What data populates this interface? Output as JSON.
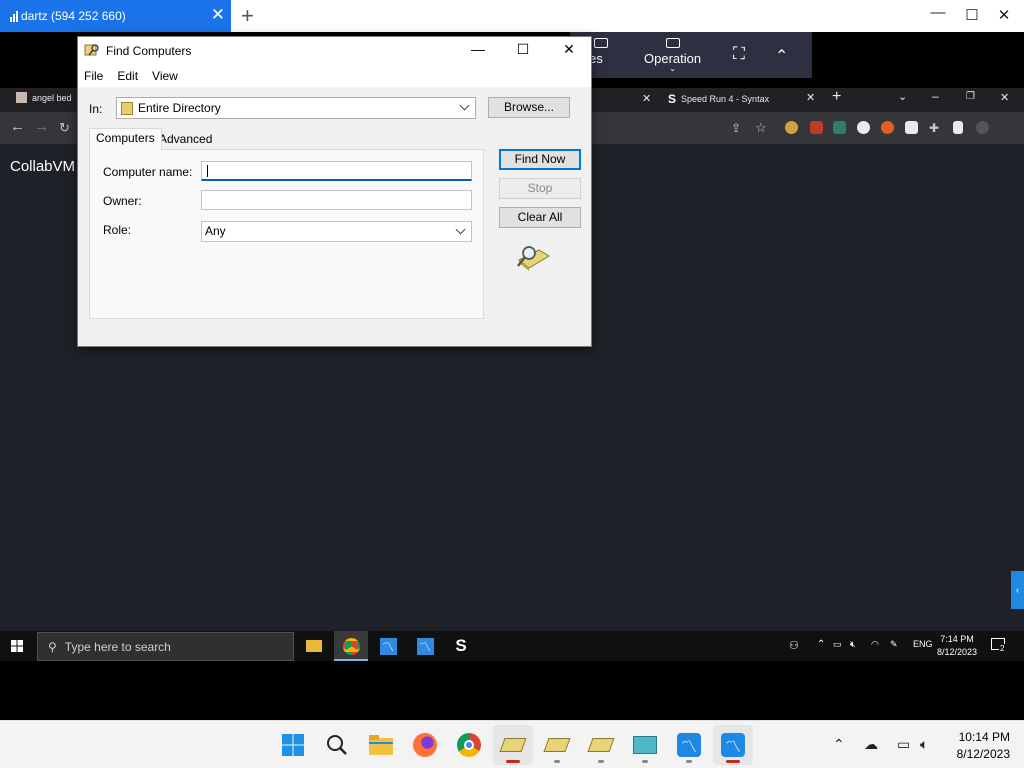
{
  "outer_window": {
    "tab_title": "dartz (594 252 660)",
    "close_glyph": "✕",
    "new_tab_glyph": "+",
    "minimize_glyph": "—",
    "maximize_glyph": "☐",
    "close_window_glyph": "✕"
  },
  "remote_toolbar": {
    "items": [
      {
        "label": "es",
        "icon": "monitor-icon"
      },
      {
        "label": "Operation",
        "icon": "keyboard-icon",
        "sub": "⌄"
      }
    ],
    "fullscreen_glyph": "⛶",
    "collapse_glyph": "⌃"
  },
  "browser": {
    "tabs": [
      {
        "label": "angel bed",
        "icon": "image-favicon"
      },
      {
        "label": "Speed Run 4 - Syntax",
        "icon": "s-logo-favicon",
        "logo": "S"
      }
    ],
    "tab_close_glyph": "✕",
    "new_tab_glyph": "+",
    "page_title": "CollabVM"
  },
  "dialog": {
    "title": "Find Computers",
    "menu": [
      "File",
      "Edit",
      "View"
    ],
    "in_label": "In:",
    "in_value": "Entire Directory",
    "browse_label": "Browse...",
    "tabs": [
      "Computers",
      "Advanced"
    ],
    "fields": {
      "computer_name_label": "Computer name:",
      "owner_label": "Owner:",
      "role_label": "Role:",
      "role_value": "Any"
    },
    "buttons": {
      "find_now": "Find Now",
      "stop": "Stop",
      "clear_all": "Clear All"
    }
  },
  "inner_taskbar": {
    "search_placeholder": "Type here to search",
    "lang": "ENG",
    "time": "7:14 PM",
    "date": "8/12/2023",
    "notification_count": "2"
  },
  "outer_taskbar": {
    "time": "10:14 PM",
    "date": "8/12/2023"
  },
  "colors": {
    "accent": "#1a73e8",
    "remote_bg": "#1f2128",
    "dialog_bg": "#f0f0f0"
  }
}
